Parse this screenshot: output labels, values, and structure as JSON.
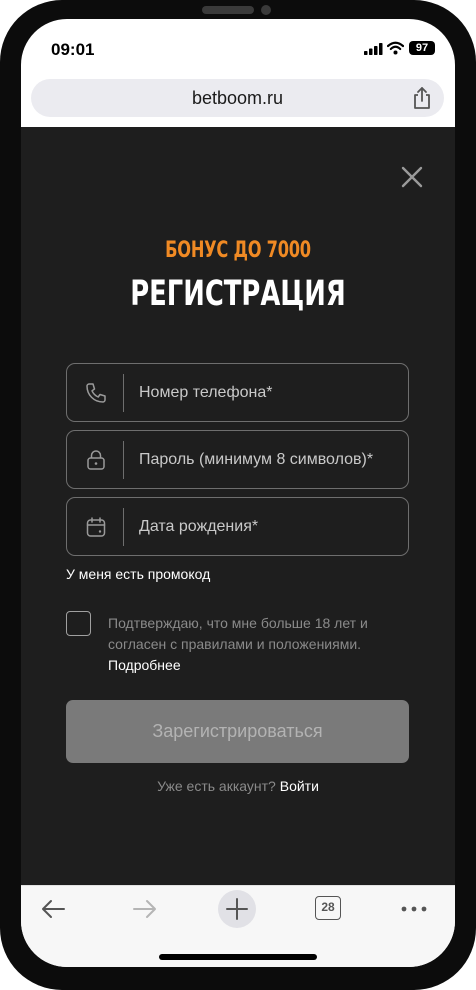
{
  "status_bar": {
    "time": "09:01",
    "battery": "97",
    "icons": [
      "signal-icon",
      "wifi-icon",
      "battery-icon"
    ]
  },
  "browser": {
    "url": "betboom.ru",
    "share_icon": "share-icon"
  },
  "registration": {
    "bonus": "БОНУС ДО 7000",
    "title": "РЕГИСТРАЦИЯ",
    "phone_placeholder": "Номер телефона*",
    "password_placeholder": "Пароль (минимум 8 символов)*",
    "birthdate_placeholder": "Дата рождения*",
    "promo_link": "У меня есть промокод",
    "consent_text": "Подтверждаю, что мне больше 18 лет и согласен с правилами и положениями.",
    "consent_more": "Подробнее",
    "register_button": "Зарегистрироваться",
    "login_question": "Уже есть аккаунт?",
    "login_link": "Войти"
  },
  "toolbar": {
    "tabs_count": "28",
    "icons": [
      "back-arrow-icon",
      "forward-arrow-icon",
      "plus-icon",
      "tabs-icon",
      "more-icon"
    ]
  },
  "colors": {
    "page_background": "#1e1e1e",
    "accent": "#f08a24",
    "button_disabled": "#7a7a7a"
  }
}
